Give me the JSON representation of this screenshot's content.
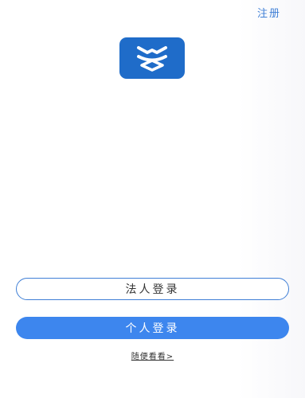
{
  "header": {
    "register_label": "注册"
  },
  "logo": {
    "icon": "app-logo-icon",
    "background_color": "#1f6cc9"
  },
  "actions": {
    "legal_person_login_label": "法人登录",
    "personal_login_label": "个人登录",
    "browse_label": "随便看看>"
  },
  "colors": {
    "accent": "#3d86ee",
    "outline": "#3f7fd6",
    "link": "#3f7fd6"
  }
}
